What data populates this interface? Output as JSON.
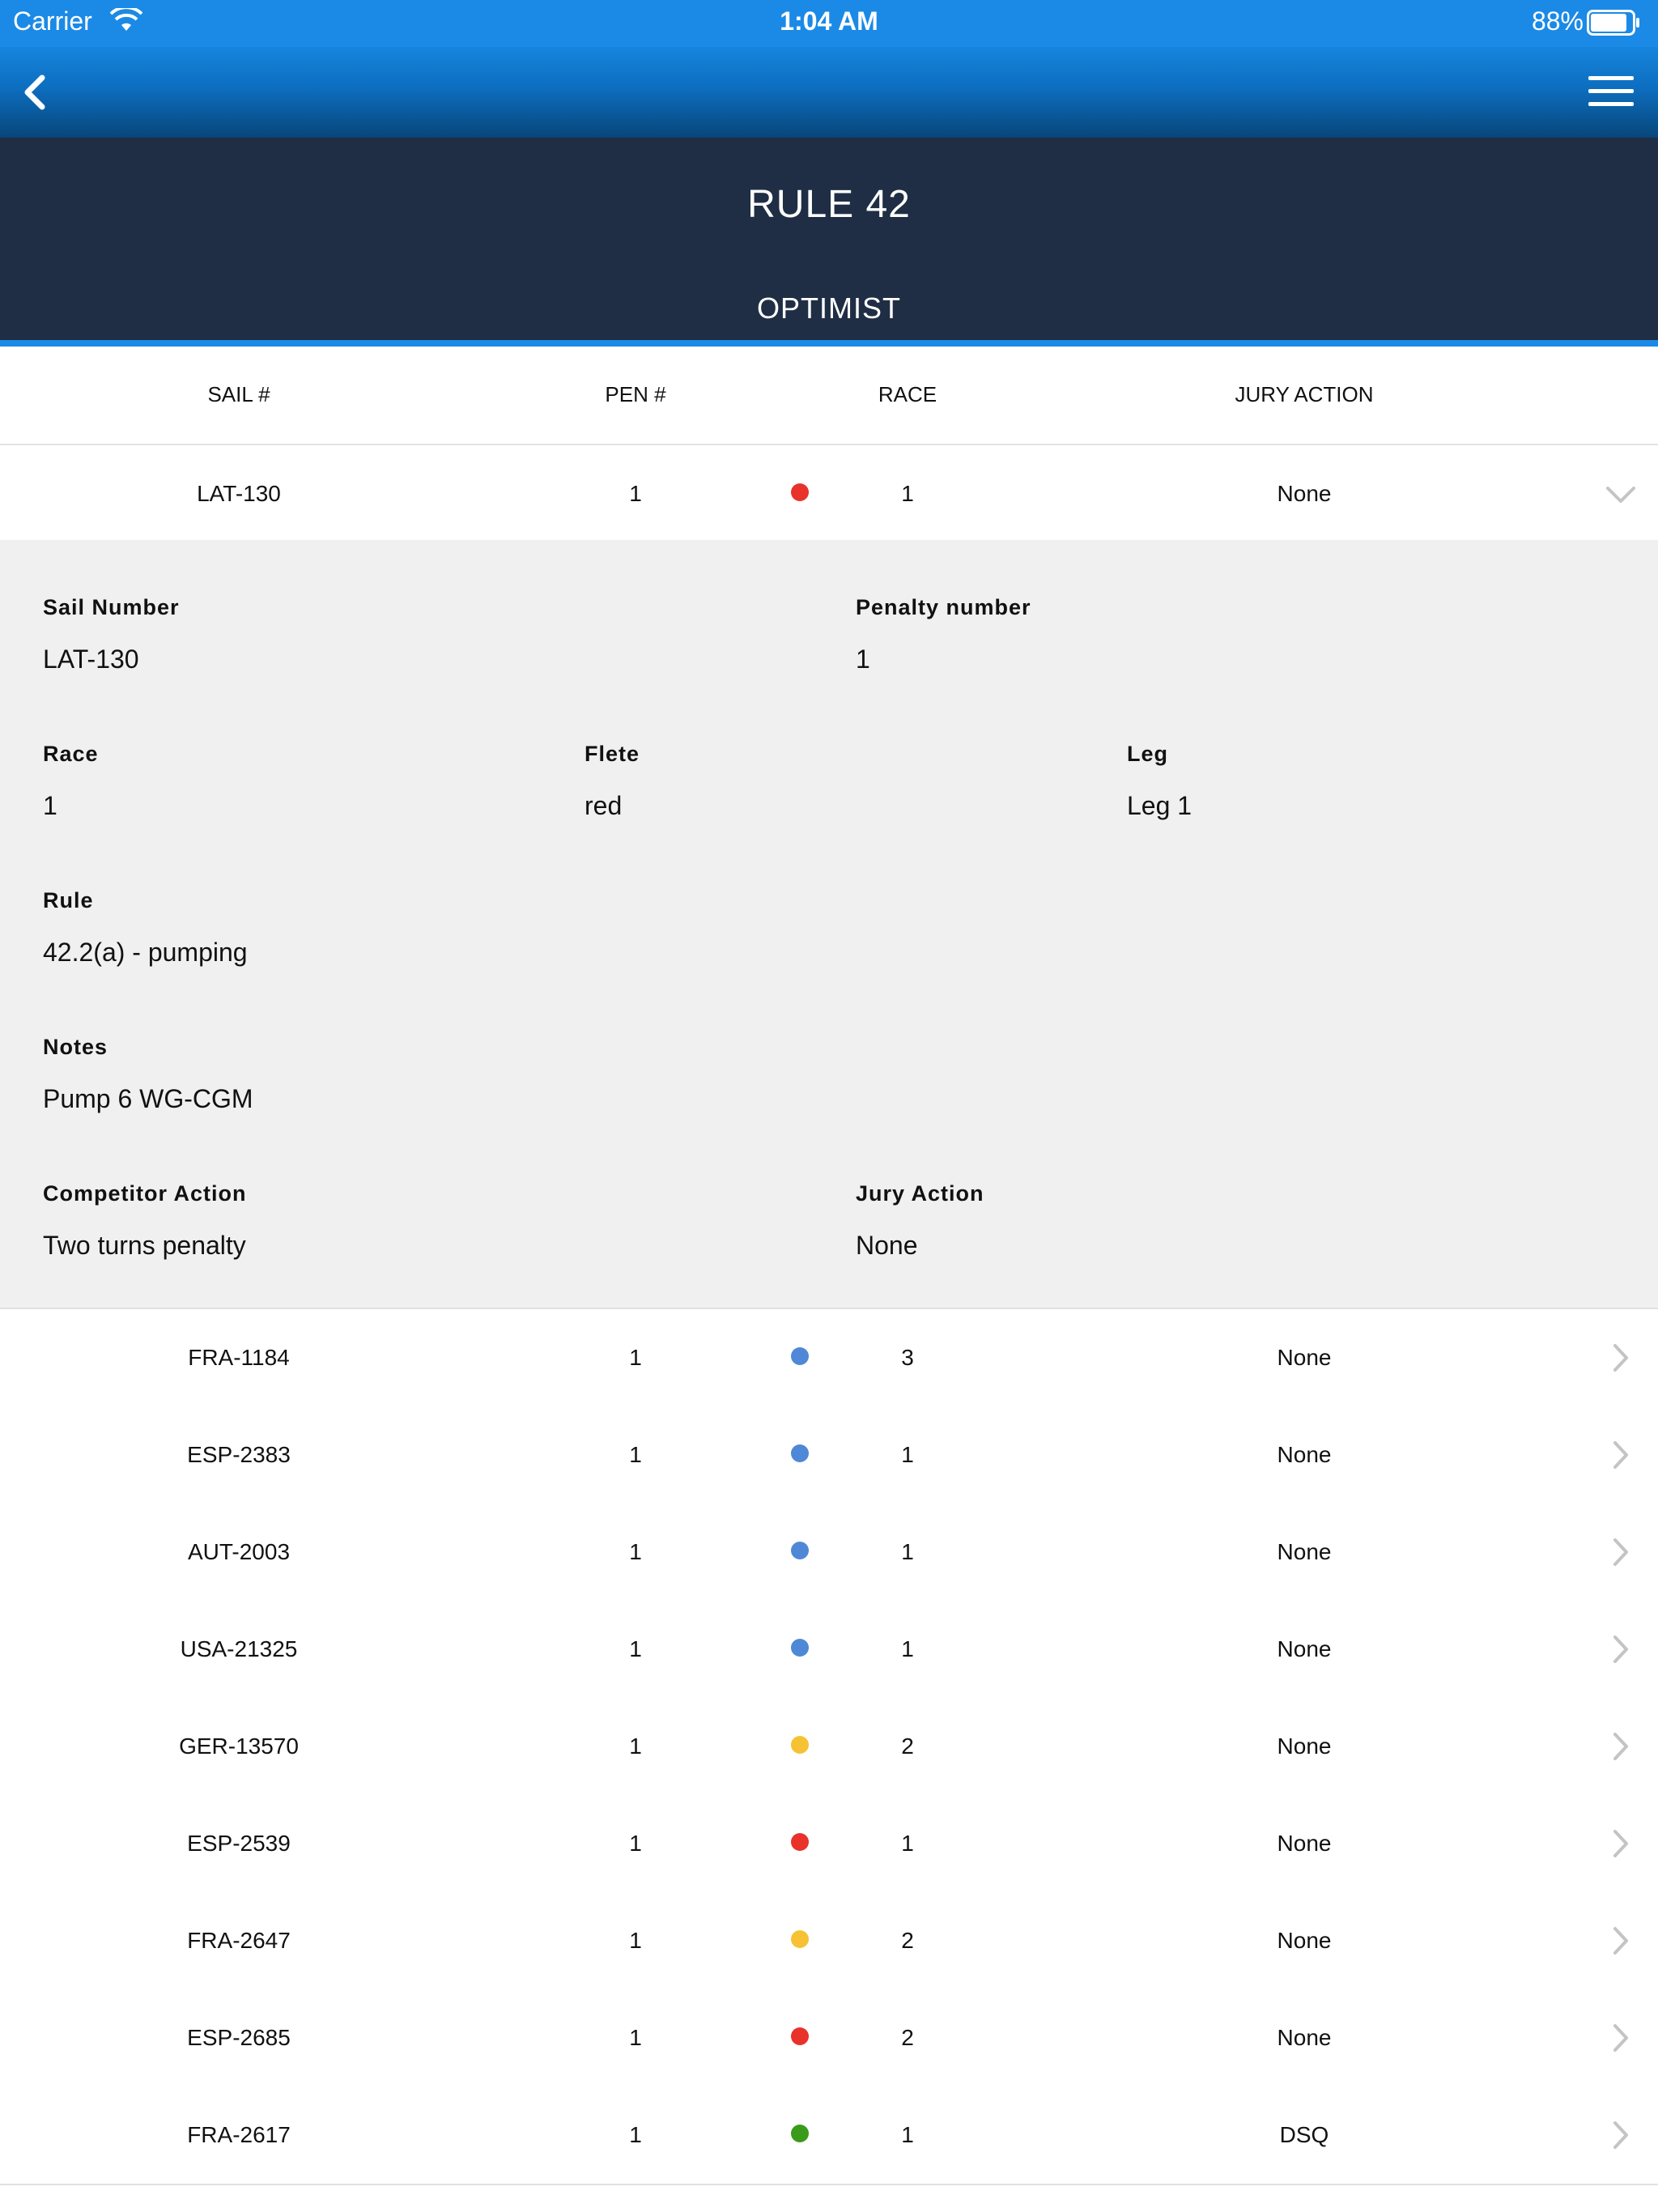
{
  "status_bar": {
    "carrier": "Carrier",
    "time": "1:04 AM",
    "battery_percent": "88%",
    "battery_level": 0.88
  },
  "nav": {
    "back_icon": "chevron-left-icon",
    "menu_icon": "hamburger-menu-icon"
  },
  "header": {
    "title": "RULE 42",
    "subtitle": "OPTIMIST"
  },
  "table": {
    "columns": [
      "SAIL #",
      "PEN #",
      "RACE",
      "JURY ACTION"
    ],
    "expanded_row": {
      "sail": "LAT-130",
      "pen": "1",
      "fleet_color": "#e8322a",
      "race": "1",
      "jury": "None"
    },
    "detail": {
      "sail_number_label": "Sail Number",
      "sail_number": "LAT-130",
      "penalty_number_label": "Penalty number",
      "penalty_number": "1",
      "race_label": "Race",
      "race": "1",
      "flete_label": "Flete",
      "flete": "red",
      "leg_label": "Leg",
      "leg": "Leg 1",
      "rule_label": "Rule",
      "rule": "42.2(a) - pumping",
      "notes_label": "Notes",
      "notes": "Pump 6 WG-CGM",
      "competitor_action_label": "Competitor Action",
      "competitor_action": "Two turns penalty",
      "jury_action_label": "Jury Action",
      "jury_action": "None"
    },
    "rows": [
      {
        "sail": "FRA-1184",
        "pen": "1",
        "fleet_color": "#4f88d6",
        "race": "3",
        "jury": "None"
      },
      {
        "sail": "ESP-2383",
        "pen": "1",
        "fleet_color": "#4f88d6",
        "race": "1",
        "jury": "None"
      },
      {
        "sail": "AUT-2003",
        "pen": "1",
        "fleet_color": "#4f88d6",
        "race": "1",
        "jury": "None"
      },
      {
        "sail": "USA-21325",
        "pen": "1",
        "fleet_color": "#4f88d6",
        "race": "1",
        "jury": "None"
      },
      {
        "sail": "GER-13570",
        "pen": "1",
        "fleet_color": "#f6c233",
        "race": "2",
        "jury": "None"
      },
      {
        "sail": "ESP-2539",
        "pen": "1",
        "fleet_color": "#e8322a",
        "race": "1",
        "jury": "None"
      },
      {
        "sail": "FRA-2647",
        "pen": "1",
        "fleet_color": "#f6c233",
        "race": "2",
        "jury": "None"
      },
      {
        "sail": "ESP-2685",
        "pen": "1",
        "fleet_color": "#e8322a",
        "race": "2",
        "jury": "None"
      },
      {
        "sail": "FRA-2617",
        "pen": "1",
        "fleet_color": "#3a9a1a",
        "race": "1",
        "jury": "DSQ"
      }
    ]
  }
}
